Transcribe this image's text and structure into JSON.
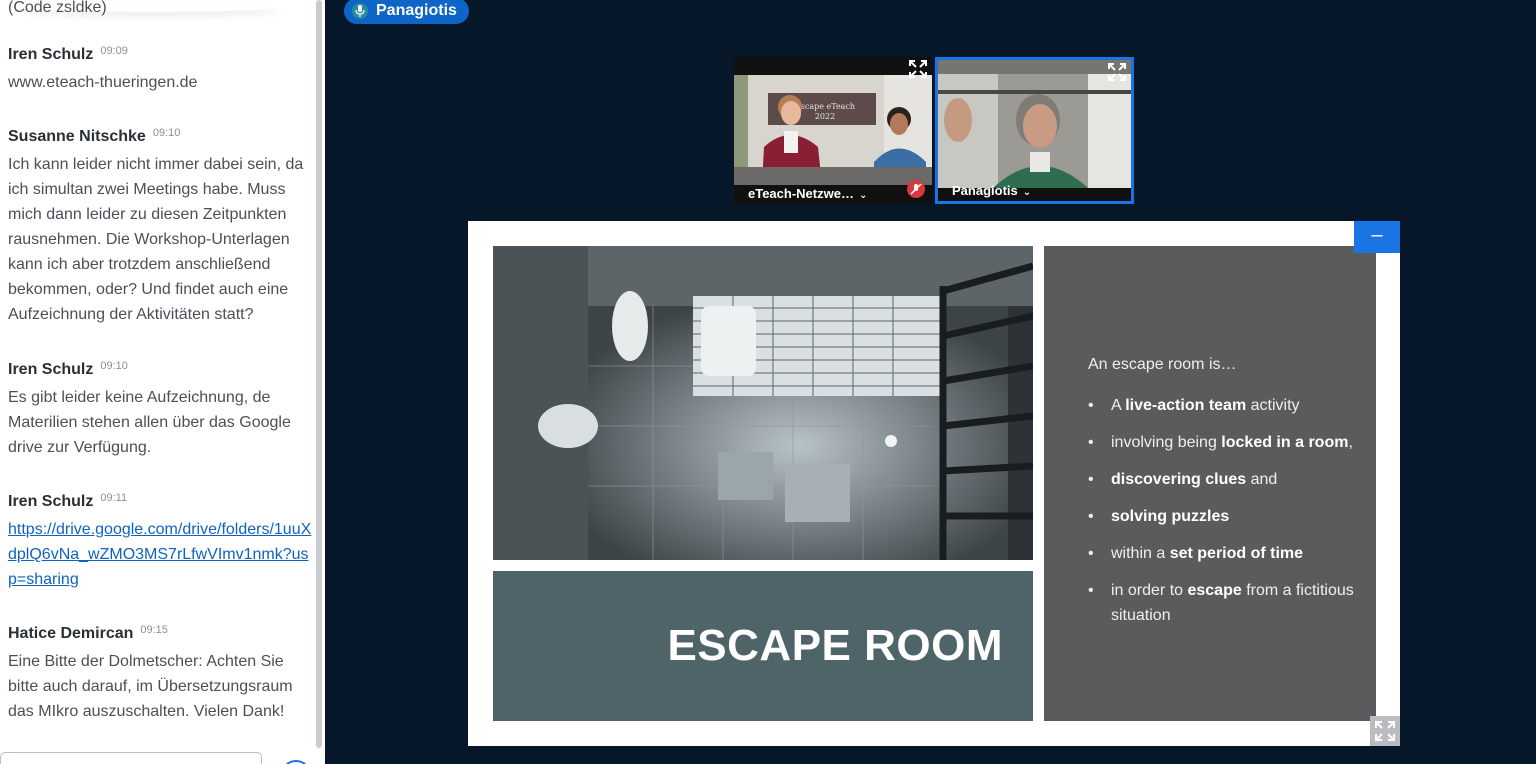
{
  "chat": {
    "top_text": "(Code zsldke)",
    "messages": [
      {
        "name": "Iren Schulz",
        "time": "09:09",
        "text": "www.eteach-thueringen.de"
      },
      {
        "name": "Susanne Nitschke",
        "time": "09:10",
        "text": "Ich kann leider nicht immer dabei sein, da ich simultan zwei Meetings habe. Muss mich dann leider zu diesen Zeitpunkten rausnehmen. Die Workshop-Unterlagen kann ich aber trotzdem anschließend bekommen, oder? Und findet auch eine Aufzeichnung der Aktivitäten statt?"
      },
      {
        "name": "Iren Schulz",
        "time": "09:10",
        "text": "Es gibt leider keine Aufzeichnung, de Materilien stehen allen über das Google drive zur Verfügung."
      },
      {
        "name": "Iren Schulz",
        "time": "09:11",
        "link": "https://drive.google.com/drive/folders/1uuXdplQ6vNa_wZMO3MS7rLfwVImv1nmk?usp=sharing"
      },
      {
        "name": "Hatice Demircan",
        "time": "09:15",
        "text": "Eine Bitte der Dolmetscher: Achten Sie bitte auch darauf, im Übersetzungsraum das MIkro auszuschalten. Vielen Dank!"
      }
    ]
  },
  "stage": {
    "talking": "Panagiotis",
    "videos": [
      {
        "name": "eTeach-Netzwe…",
        "muted": true,
        "banner_line1": "Escape eTeach",
        "banner_line2": "2022"
      },
      {
        "name": "Panagiotis",
        "active": true
      }
    ]
  },
  "slide": {
    "title": "ESCAPE ROOM",
    "intro": "An escape room is…",
    "bullets": [
      {
        "parts": [
          {
            "t": "A "
          },
          {
            "b": "live-action team"
          },
          {
            "t": " activity"
          }
        ]
      },
      {
        "parts": [
          {
            "t": "involving being "
          },
          {
            "b": "locked in a room"
          },
          {
            "t": ","
          }
        ]
      },
      {
        "parts": [
          {
            "b": "discovering clues"
          },
          {
            "t": " and"
          }
        ]
      },
      {
        "parts": [
          {
            "b": "solving puzzles"
          }
        ]
      },
      {
        "parts": [
          {
            "t": "within a "
          },
          {
            "b": "set period of time"
          }
        ]
      },
      {
        "parts": [
          {
            "t": "in order to "
          },
          {
            "b": "escape"
          },
          {
            "t": " from a fictitious situation"
          }
        ]
      }
    ]
  },
  "colors": {
    "accent": "#1b74e4",
    "stage_bg": "#06172a",
    "link": "#0f63c0"
  }
}
